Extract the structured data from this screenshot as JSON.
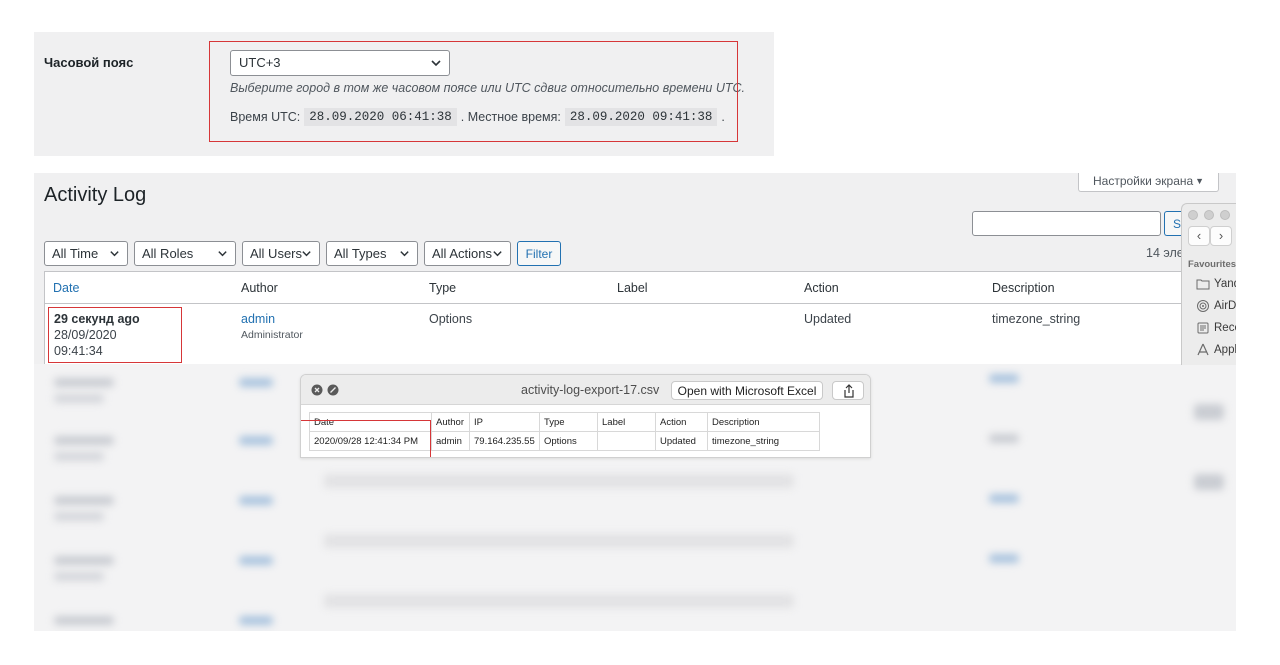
{
  "timezone": {
    "label": "Часовой пояс",
    "selected": "UTC+3",
    "hint": "Выберите город в том же часовом поясе или UTC сдвиг относительно времени UTC.",
    "utc_label": "Время UTC:",
    "utc_value": "28.09.2020 06:41:38",
    "local_label": ". Местное время:",
    "local_value": "28.09.2020 09:41:38",
    "trailing": "."
  },
  "log": {
    "title": "Activity Log",
    "screen_options": "Настройки экрана",
    "search_button": "S",
    "filters": [
      "All Time",
      "All Roles",
      "All Users",
      "All Types",
      "All Actions"
    ],
    "filter_button": "Filter",
    "items_count": "14 эле",
    "columns": [
      "Date",
      "Author",
      "Type",
      "Label",
      "Action",
      "Description"
    ],
    "row": {
      "ago": "29 секунд ago",
      "date": "28/09/2020",
      "time": "09:41:34",
      "author": "admin",
      "role": "Administrator",
      "type": "Options",
      "label": "",
      "action": "Updated",
      "description": "timezone_string"
    }
  },
  "finder": {
    "section": "Favourites",
    "items": [
      "Yand",
      "AirD",
      "Rece",
      "Appl"
    ]
  },
  "csv": {
    "filename": "activity-log-export-17.csv",
    "open_button": "Open with Microsoft Excel",
    "columns": [
      "Date",
      "Author",
      "IP",
      "Type",
      "Label",
      "Action",
      "Description"
    ],
    "row": [
      "2020/09/28 12:41:34 PM",
      "admin",
      "79.164.235.55",
      "Options",
      "",
      "Updated",
      "timezone_string"
    ]
  },
  "colors": {
    "accent": "#2271b1",
    "highlight": "#d63638",
    "panel": "#f0f0f1"
  }
}
